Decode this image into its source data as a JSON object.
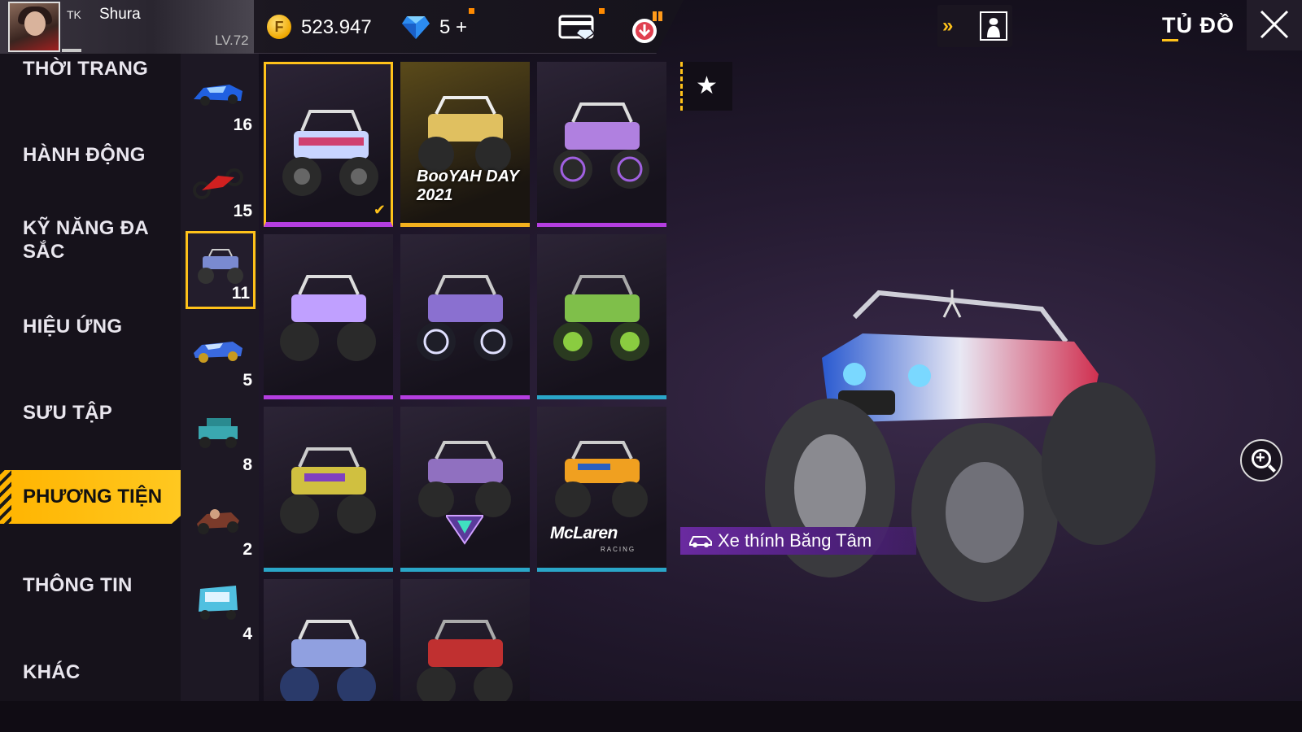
{
  "player": {
    "tag": "TK",
    "name": "Shura",
    "level": "LV.72"
  },
  "currency": {
    "coin_symbol": "F",
    "coins": "523.947",
    "diamonds": "5 +"
  },
  "header": {
    "title": "TỦ ĐỒ"
  },
  "sidebar": {
    "categories": [
      "THỜI TRANG",
      "HÀNH ĐỘNG",
      "KỸ NĂNG ĐA SẮC",
      "HIỆU ỨNG",
      "SƯU TẬP",
      "PHƯƠNG TIỆN",
      "THÔNG TIN",
      "KHÁC"
    ],
    "active": "PHƯƠNG TIỆN"
  },
  "subcategories": [
    {
      "icon": "sports-car-icon",
      "count": "16"
    },
    {
      "icon": "motorbike-icon",
      "count": "15"
    },
    {
      "icon": "monster-truck-icon",
      "count": "11",
      "active": true
    },
    {
      "icon": "muscle-car-icon",
      "count": "5"
    },
    {
      "icon": "jeep-icon",
      "count": "8"
    },
    {
      "icon": "kart-icon",
      "count": "2"
    },
    {
      "icon": "tuk-tuk-icon",
      "count": "4"
    }
  ],
  "grid": {
    "items": [
      {
        "icon": "monster-truck-icon",
        "color": "#c8d4ff",
        "accent": "#b43ee0",
        "selected": true
      },
      {
        "icon": "monster-truck-icon",
        "color": "#e0c060",
        "accent": "#f2b01e",
        "badge": "BooYAH DAY 2021"
      },
      {
        "icon": "monster-truck-icon",
        "color": "#b080e0",
        "accent": "#b43ee0"
      },
      {
        "icon": "monster-truck-icon",
        "color": "#c0a0ff",
        "accent": "#b43ee0"
      },
      {
        "icon": "monster-truck-icon",
        "color": "#8a70d0",
        "accent": "#b43ee0"
      },
      {
        "icon": "monster-truck-icon",
        "color": "#7fbf4a",
        "accent": "#2aa6c8"
      },
      {
        "icon": "monster-truck-icon",
        "color": "#d0c040",
        "accent": "#2aa6c8"
      },
      {
        "icon": "monster-truck-icon",
        "color": "#9070c0",
        "accent": "#2aa6c8"
      },
      {
        "icon": "monster-truck-icon",
        "color": "#f0a020",
        "accent": "#2aa6c8",
        "brand": "McLaren",
        "brand_sub": "RACING"
      },
      {
        "icon": "monster-truck-icon",
        "color": "#90a0e0",
        "accent": "#b43ee0"
      },
      {
        "icon": "monster-truck-icon",
        "color": "#c03030",
        "accent": "#b43ee0"
      }
    ]
  },
  "preview": {
    "vehicle_name": "Xe thính Băng Tâm"
  },
  "colors": {
    "accent_gold": "#ffc21a",
    "rarity_purple": "#b43ee0",
    "rarity_teal": "#2aa6c8"
  }
}
